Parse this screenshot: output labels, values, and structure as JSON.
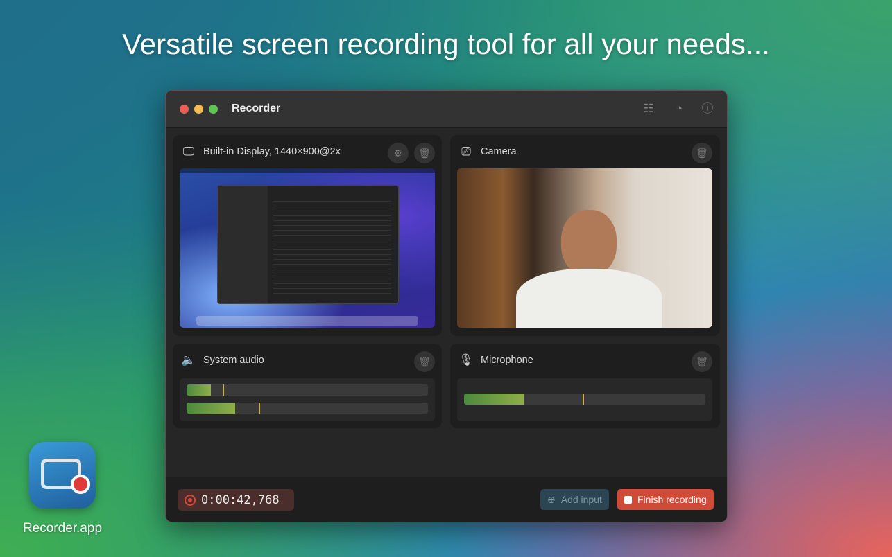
{
  "headline": "Versatile screen recording tool for all your needs...",
  "window": {
    "title": "Recorder",
    "toolbar_icons": [
      "layout-icon",
      "speedometer-icon",
      "info-icon"
    ]
  },
  "inputs": {
    "display": {
      "label": "Built-in Display, 1440×900@2x"
    },
    "camera": {
      "label": "Camera"
    },
    "system_audio": {
      "label": "System audio",
      "levels": [
        {
          "level": 0.1,
          "peak": 0.15
        },
        {
          "level": 0.2,
          "peak": 0.3
        }
      ]
    },
    "microphone": {
      "label": "Microphone",
      "levels": [
        {
          "level": 0.25,
          "peak": 0.49
        }
      ]
    }
  },
  "footer": {
    "timer": "0:00:42,768",
    "add_input": "Add input",
    "finish": "Finish recording"
  },
  "colors": {
    "record_red": "#d8473a",
    "meter_green": "#6fa044",
    "peak": "#c9b04a"
  },
  "dock_app": {
    "label": "Recorder.app"
  }
}
